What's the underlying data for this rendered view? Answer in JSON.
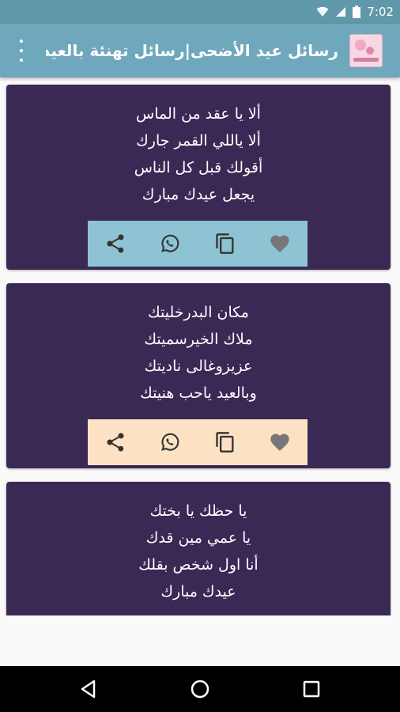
{
  "status_bar": {
    "time": "7:02"
  },
  "app_bar": {
    "title": "رسائل عيد الأضحى|رسائل تهنئة بالعيد"
  },
  "cards": [
    {
      "lines": [
        "ألا يا عقد من الماس",
        "ألا ياللي القمر جارك",
        "أقولك قبل كل الناس",
        "يجعل عيدك مبارك"
      ],
      "action_bar_color": "#8ec3d3"
    },
    {
      "lines": [
        "مكان البدرخليتك",
        "ملاك الخيرسميتك",
        "عزيزوغالى ناديتك",
        "وبالعيد ياحب هنيتك"
      ],
      "action_bar_color": "#fde1c3"
    },
    {
      "lines": [
        "يا حظك يا بختك",
        "يا عمي مين قدك",
        "أنا اول شخص بقلك",
        "عيدك مبارك"
      ],
      "action_bar_color": "#8ec3d3"
    }
  ],
  "colors": {
    "status_bar": "#5f98a9",
    "app_bar": "#6fa8bc",
    "card_bg": "#3a2855",
    "action_icon": "#333333",
    "heart_icon": "#777777"
  }
}
